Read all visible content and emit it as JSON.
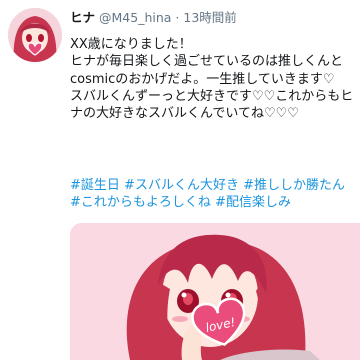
{
  "tweet": {
    "display_name": "ヒナ",
    "handle": "@M45_hina",
    "separator": "·",
    "time": "13時間前",
    "text_lines": [
      "XX歳になりました！",
      "ヒナが毎日楽しく過ごせているのは推しくんとcosmicのおかげだよ。一生推していきます♡",
      "スバルくんずーっと大好きです♡♡これからもヒナの大好きなスバルくんでいてね♡♡♡"
    ],
    "hashtags": [
      "#誕生日",
      "#スバルくん大好き",
      "#推ししか勝たん",
      "#これからもよろしくね",
      "#配信楽しみ"
    ],
    "image_text": "love!"
  },
  "colors": {
    "link": "#1b95e0",
    "muted": "#657786",
    "text": "#14171a",
    "hair": "#c8354f",
    "image_bg": "#fbd9e2"
  }
}
